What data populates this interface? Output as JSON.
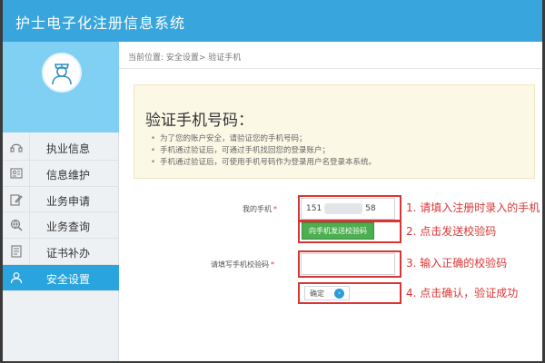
{
  "app": {
    "title": "护士电子化注册信息系统"
  },
  "user": {
    "name": ""
  },
  "sidebar": {
    "items": [
      {
        "label": "执业信息",
        "icon": "headset-icon",
        "active": false
      },
      {
        "label": "信息维护",
        "icon": "id-card-icon",
        "active": false
      },
      {
        "label": "业务申请",
        "icon": "edit-icon",
        "active": false
      },
      {
        "label": "业务查询",
        "icon": "search-globe-icon",
        "active": false
      },
      {
        "label": "证书补办",
        "icon": "document-icon",
        "active": false
      },
      {
        "label": "安全设置",
        "icon": "user-shield-icon",
        "active": true
      }
    ]
  },
  "breadcrumb": {
    "text": "当前位置: 安全设置> 验证手机"
  },
  "notice": {
    "title": "验证手机号码：",
    "items": [
      "为了您的账户安全，请验证您的手机号码；",
      "手机通过验证后，可通过手机找回您的登录账户；",
      "手机通过验证后，可使用手机号码作为登录用户名登录本系统。"
    ]
  },
  "form": {
    "phone_label": "我的手机",
    "phone_prefix": "151",
    "phone_suffix": "58",
    "send_code_label": "向手机发送校验码",
    "code_label": "请填写手机校验码",
    "code_value": "",
    "confirm_label": "确定",
    "required_mark": "*"
  },
  "annotations": {
    "step1": "1. 请填入注册时录入的手机",
    "step2": "2. 点击发送校验码",
    "step3": "3. 输入正确的校验码",
    "step4": "4. 点击确认，验证成功"
  },
  "colors": {
    "header": "#38a6dc",
    "profile": "#80d0f4",
    "active_menu": "#29a4de",
    "send_button": "#4caf50",
    "annotation_red": "#d93535"
  }
}
